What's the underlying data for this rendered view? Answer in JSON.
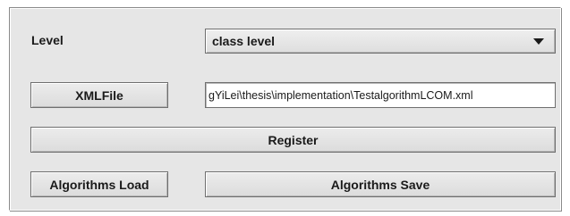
{
  "form": {
    "level_label": "Level",
    "level_select": {
      "selected_value": "class level"
    },
    "xmlfile_button": "XMLFile",
    "xmlfile_path": "gYiLei\\thesis\\implementation\\TestalgorithmLCOM.xml",
    "register_button": "Register",
    "algorithms_load_button": "Algorithms Load",
    "algorithms_save_button": "Algorithms Save"
  },
  "icons": {
    "dropdown": "chevron-down-icon"
  },
  "colors": {
    "panel_background": "#e6e6e6",
    "button_border": "#6f6f6f",
    "text": "#1a1a1a"
  }
}
